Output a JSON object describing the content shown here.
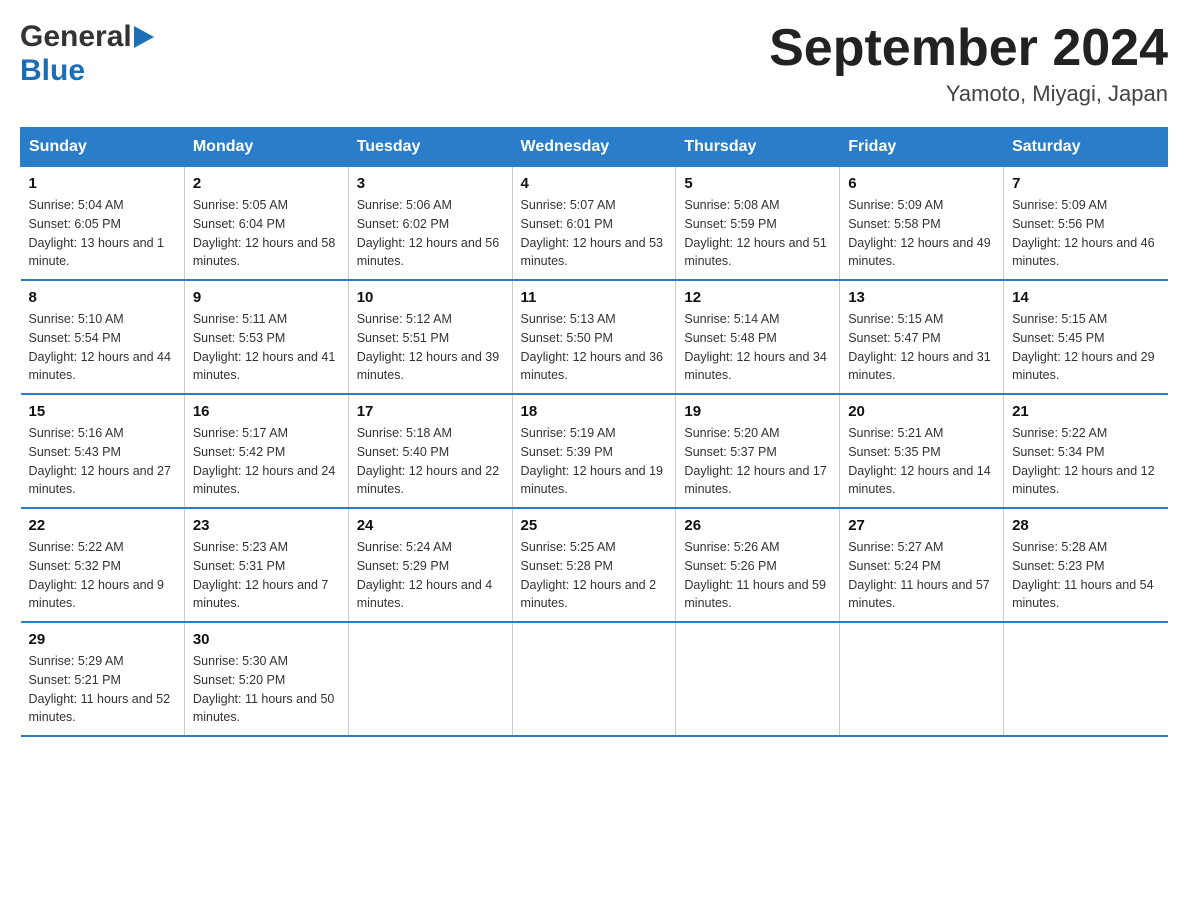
{
  "header": {
    "logo_general": "General",
    "logo_blue": "Blue",
    "title": "September 2024",
    "subtitle": "Yamoto, Miyagi, Japan"
  },
  "weekdays": [
    "Sunday",
    "Monday",
    "Tuesday",
    "Wednesday",
    "Thursday",
    "Friday",
    "Saturday"
  ],
  "weeks": [
    [
      {
        "day": "1",
        "sunrise": "Sunrise: 5:04 AM",
        "sunset": "Sunset: 6:05 PM",
        "daylight": "Daylight: 13 hours and 1 minute."
      },
      {
        "day": "2",
        "sunrise": "Sunrise: 5:05 AM",
        "sunset": "Sunset: 6:04 PM",
        "daylight": "Daylight: 12 hours and 58 minutes."
      },
      {
        "day": "3",
        "sunrise": "Sunrise: 5:06 AM",
        "sunset": "Sunset: 6:02 PM",
        "daylight": "Daylight: 12 hours and 56 minutes."
      },
      {
        "day": "4",
        "sunrise": "Sunrise: 5:07 AM",
        "sunset": "Sunset: 6:01 PM",
        "daylight": "Daylight: 12 hours and 53 minutes."
      },
      {
        "day": "5",
        "sunrise": "Sunrise: 5:08 AM",
        "sunset": "Sunset: 5:59 PM",
        "daylight": "Daylight: 12 hours and 51 minutes."
      },
      {
        "day": "6",
        "sunrise": "Sunrise: 5:09 AM",
        "sunset": "Sunset: 5:58 PM",
        "daylight": "Daylight: 12 hours and 49 minutes."
      },
      {
        "day": "7",
        "sunrise": "Sunrise: 5:09 AM",
        "sunset": "Sunset: 5:56 PM",
        "daylight": "Daylight: 12 hours and 46 minutes."
      }
    ],
    [
      {
        "day": "8",
        "sunrise": "Sunrise: 5:10 AM",
        "sunset": "Sunset: 5:54 PM",
        "daylight": "Daylight: 12 hours and 44 minutes."
      },
      {
        "day": "9",
        "sunrise": "Sunrise: 5:11 AM",
        "sunset": "Sunset: 5:53 PM",
        "daylight": "Daylight: 12 hours and 41 minutes."
      },
      {
        "day": "10",
        "sunrise": "Sunrise: 5:12 AM",
        "sunset": "Sunset: 5:51 PM",
        "daylight": "Daylight: 12 hours and 39 minutes."
      },
      {
        "day": "11",
        "sunrise": "Sunrise: 5:13 AM",
        "sunset": "Sunset: 5:50 PM",
        "daylight": "Daylight: 12 hours and 36 minutes."
      },
      {
        "day": "12",
        "sunrise": "Sunrise: 5:14 AM",
        "sunset": "Sunset: 5:48 PM",
        "daylight": "Daylight: 12 hours and 34 minutes."
      },
      {
        "day": "13",
        "sunrise": "Sunrise: 5:15 AM",
        "sunset": "Sunset: 5:47 PM",
        "daylight": "Daylight: 12 hours and 31 minutes."
      },
      {
        "day": "14",
        "sunrise": "Sunrise: 5:15 AM",
        "sunset": "Sunset: 5:45 PM",
        "daylight": "Daylight: 12 hours and 29 minutes."
      }
    ],
    [
      {
        "day": "15",
        "sunrise": "Sunrise: 5:16 AM",
        "sunset": "Sunset: 5:43 PM",
        "daylight": "Daylight: 12 hours and 27 minutes."
      },
      {
        "day": "16",
        "sunrise": "Sunrise: 5:17 AM",
        "sunset": "Sunset: 5:42 PM",
        "daylight": "Daylight: 12 hours and 24 minutes."
      },
      {
        "day": "17",
        "sunrise": "Sunrise: 5:18 AM",
        "sunset": "Sunset: 5:40 PM",
        "daylight": "Daylight: 12 hours and 22 minutes."
      },
      {
        "day": "18",
        "sunrise": "Sunrise: 5:19 AM",
        "sunset": "Sunset: 5:39 PM",
        "daylight": "Daylight: 12 hours and 19 minutes."
      },
      {
        "day": "19",
        "sunrise": "Sunrise: 5:20 AM",
        "sunset": "Sunset: 5:37 PM",
        "daylight": "Daylight: 12 hours and 17 minutes."
      },
      {
        "day": "20",
        "sunrise": "Sunrise: 5:21 AM",
        "sunset": "Sunset: 5:35 PM",
        "daylight": "Daylight: 12 hours and 14 minutes."
      },
      {
        "day": "21",
        "sunrise": "Sunrise: 5:22 AM",
        "sunset": "Sunset: 5:34 PM",
        "daylight": "Daylight: 12 hours and 12 minutes."
      }
    ],
    [
      {
        "day": "22",
        "sunrise": "Sunrise: 5:22 AM",
        "sunset": "Sunset: 5:32 PM",
        "daylight": "Daylight: 12 hours and 9 minutes."
      },
      {
        "day": "23",
        "sunrise": "Sunrise: 5:23 AM",
        "sunset": "Sunset: 5:31 PM",
        "daylight": "Daylight: 12 hours and 7 minutes."
      },
      {
        "day": "24",
        "sunrise": "Sunrise: 5:24 AM",
        "sunset": "Sunset: 5:29 PM",
        "daylight": "Daylight: 12 hours and 4 minutes."
      },
      {
        "day": "25",
        "sunrise": "Sunrise: 5:25 AM",
        "sunset": "Sunset: 5:28 PM",
        "daylight": "Daylight: 12 hours and 2 minutes."
      },
      {
        "day": "26",
        "sunrise": "Sunrise: 5:26 AM",
        "sunset": "Sunset: 5:26 PM",
        "daylight": "Daylight: 11 hours and 59 minutes."
      },
      {
        "day": "27",
        "sunrise": "Sunrise: 5:27 AM",
        "sunset": "Sunset: 5:24 PM",
        "daylight": "Daylight: 11 hours and 57 minutes."
      },
      {
        "day": "28",
        "sunrise": "Sunrise: 5:28 AM",
        "sunset": "Sunset: 5:23 PM",
        "daylight": "Daylight: 11 hours and 54 minutes."
      }
    ],
    [
      {
        "day": "29",
        "sunrise": "Sunrise: 5:29 AM",
        "sunset": "Sunset: 5:21 PM",
        "daylight": "Daylight: 11 hours and 52 minutes."
      },
      {
        "day": "30",
        "sunrise": "Sunrise: 5:30 AM",
        "sunset": "Sunset: 5:20 PM",
        "daylight": "Daylight: 11 hours and 50 minutes."
      },
      null,
      null,
      null,
      null,
      null
    ]
  ]
}
